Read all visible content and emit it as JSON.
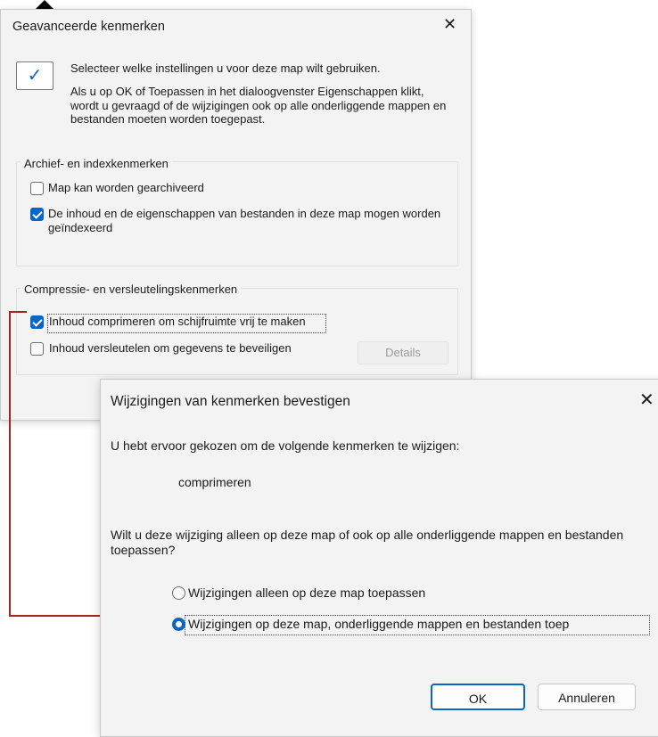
{
  "dialog1": {
    "title": "Geavanceerde kenmerken",
    "close_glyph": "✕",
    "intro_line1": "Selecteer welke instellingen u voor deze map wilt gebruiken.",
    "intro_line2": "Als u op OK of Toepassen in het dialoogvenster Eigenschappen klikt, wordt u gevraagd of de wijzigingen ook op alle onderliggende mappen en bestanden moeten worden toegepast.",
    "group_archive": {
      "label": "Archief- en indexkenmerken",
      "items": [
        {
          "label": "Map kan worden gearchiveerd",
          "checked": false
        },
        {
          "label": "De inhoud en de eigenschappen van bestanden in deze map mogen worden geïndexeerd",
          "checked": true
        }
      ]
    },
    "group_compress": {
      "label": "Compressie- en versleutelingskenmerken",
      "items": [
        {
          "label": "Inhoud comprimeren om schijfruimte vrij te maken",
          "checked": true
        },
        {
          "label": "Inhoud versleutelen om gegevens te beveiligen",
          "checked": false
        }
      ],
      "details_button": "Details"
    }
  },
  "dialog2": {
    "title": "Wijzigingen van kenmerken bevestigen",
    "close_glyph": "✕",
    "line1": "U hebt ervoor gekozen om de volgende kenmerken te wijzigen:",
    "attribute": "comprimeren",
    "question": "Wilt u deze wijziging alleen op deze map of ook op alle onderliggende mappen en bestanden toepassen?",
    "options": [
      {
        "label": "Wijzigingen alleen op deze map toepassen",
        "selected": false
      },
      {
        "label": "Wijzigingen op deze map, onderliggende mappen en bestanden toep",
        "selected": true
      }
    ],
    "ok_button": "OK",
    "cancel_button": "Annuleren"
  },
  "colors": {
    "accent": "#0b65c4",
    "connector": "#a12622",
    "dialog_bg": "#f3f3f3"
  }
}
